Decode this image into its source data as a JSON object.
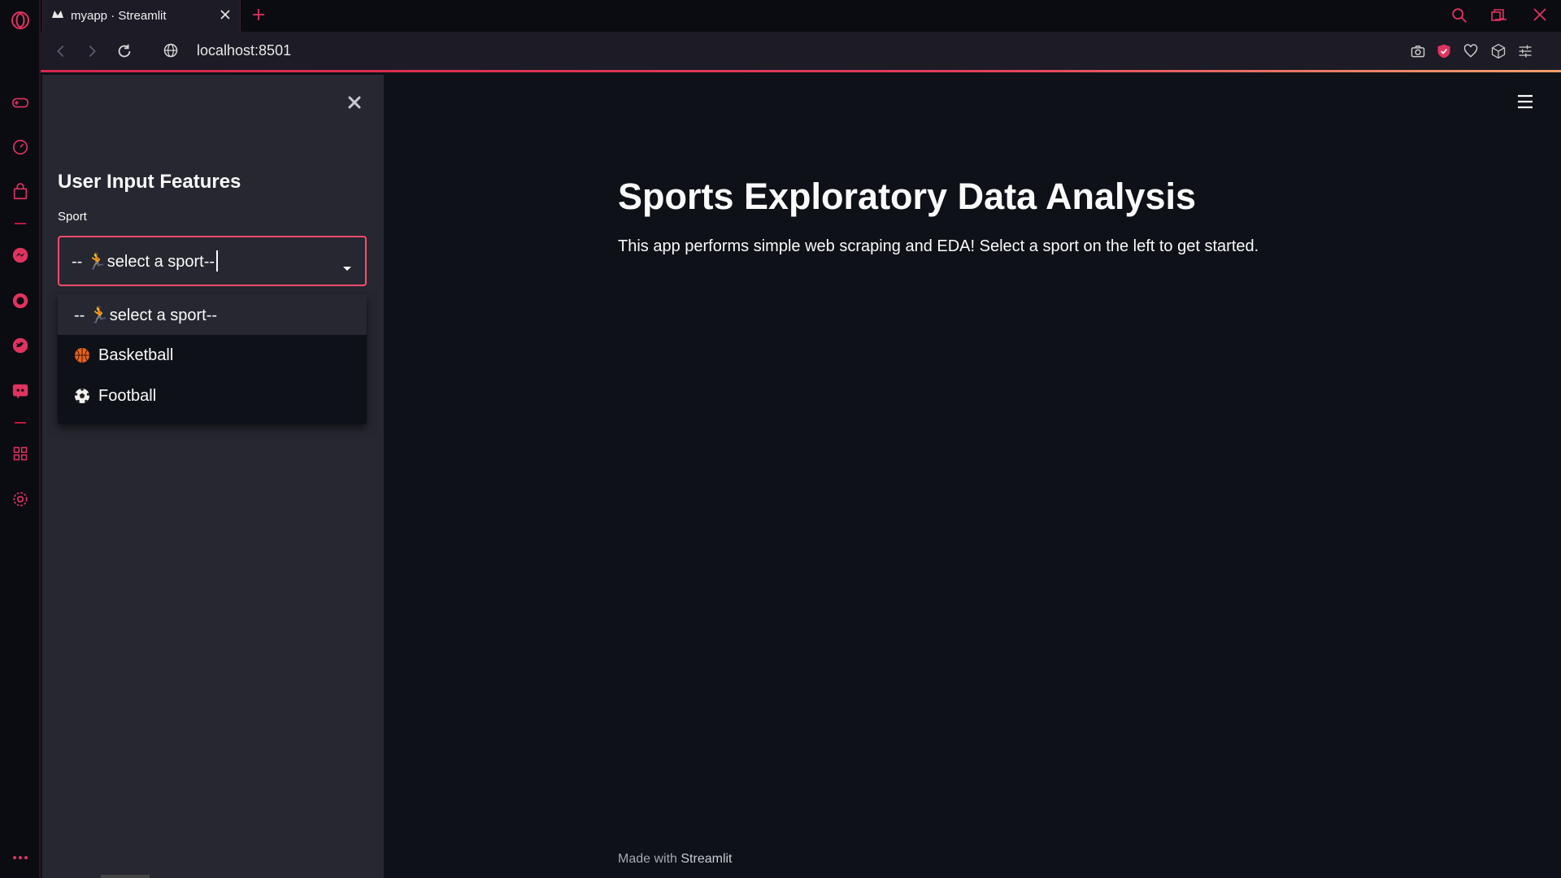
{
  "browser": {
    "tab_title": "myapp · Streamlit",
    "url": "localhost:8501",
    "accent": "#e0335f"
  },
  "rail": {
    "icons": [
      "opera-logo-icon",
      "gamepad-icon",
      "speed-dial-icon",
      "shopping-bag-icon",
      "messenger-icon",
      "whatsapp-icon",
      "twitter-icon",
      "discord-icon",
      "extensions-icon",
      "settings-icon",
      "more-icon"
    ]
  },
  "sidebar": {
    "header": "User Input Features",
    "select_label": "Sport",
    "selected_value": "-- 🏃select a sport--",
    "options": [
      {
        "label": "-- 🏃select a sport--",
        "icon": "runner-icon"
      },
      {
        "label": "Basketball",
        "icon": "basketball-icon"
      },
      {
        "label": "Football",
        "icon": "soccer-ball-icon"
      }
    ]
  },
  "main": {
    "title": "Sports Exploratory Data Analysis",
    "description": "This app performs simple web scraping and EDA! Select a sport on the left to get started.",
    "footer_prefix": "Made with ",
    "footer_brand": "Streamlit"
  },
  "colors": {
    "app_bg": "#0e1117",
    "sidebar_bg": "#262730",
    "focus_border": "#ff4b6b"
  }
}
